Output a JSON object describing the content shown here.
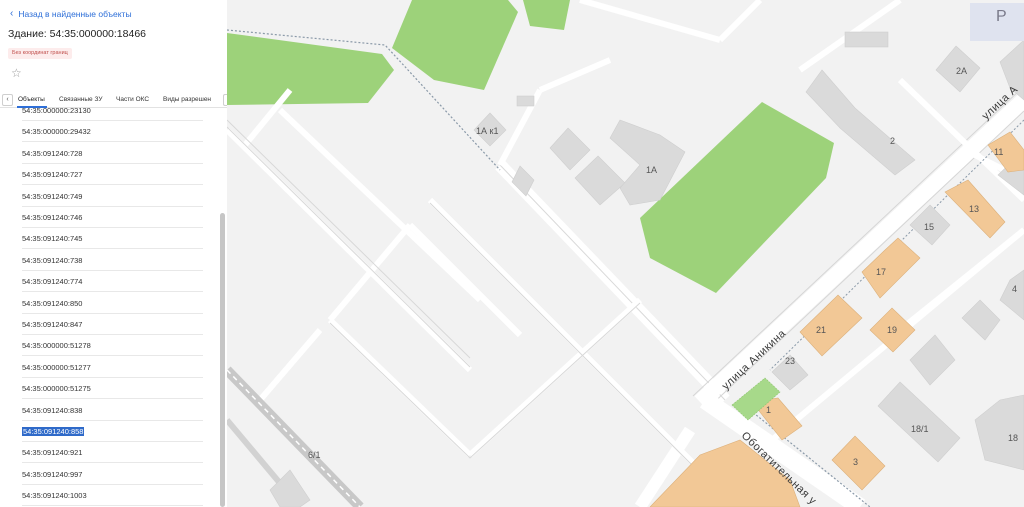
{
  "panel": {
    "back_label": "Назад в найденные объекты",
    "title": "Здание: 54:35:000000:18466",
    "badge": "Без координат границ",
    "tabs": [
      {
        "label": "Объекты"
      },
      {
        "label": "Связанные ЗУ"
      },
      {
        "label": "Части ОКС"
      },
      {
        "label": "Виды разрешен"
      }
    ],
    "list": [
      {
        "label": "54:35:000000:23130"
      },
      {
        "label": "54:35:000000:29432"
      },
      {
        "label": "54:35:091240:728"
      },
      {
        "label": "54:35:091240:727"
      },
      {
        "label": "54:35:091240:749"
      },
      {
        "label": "54:35:091240:746"
      },
      {
        "label": "54:35:091240:745"
      },
      {
        "label": "54:35:091240:738"
      },
      {
        "label": "54:35:091240:774"
      },
      {
        "label": "54:35:091240:850"
      },
      {
        "label": "54:35:091240:847"
      },
      {
        "label": "54:35:000000:51278"
      },
      {
        "label": "54:35:000000:51277"
      },
      {
        "label": "54:35:000000:51275"
      },
      {
        "label": "54:35:091240:838"
      },
      {
        "label": "54:35:091240:858"
      },
      {
        "label": "54:35:091240:921"
      },
      {
        "label": "54:35:091240:997"
      },
      {
        "label": "54:35:091240:1003"
      }
    ],
    "selected_index": 15
  },
  "map": {
    "streets": {
      "anikina": "улица Аникина",
      "obogatitelnaya": "Обогатительная у",
      "top_right": "улица А"
    },
    "house_numbers": {
      "b1a_k1": "1А к1",
      "b1a": "1А",
      "b2a": "2А",
      "b2": "2",
      "b11": "11",
      "b13": "13",
      "b15": "15",
      "b17": "17",
      "b4": "4",
      "b21": "21",
      "b19": "19",
      "b23": "23",
      "b1": "1",
      "b18_1": "18/1",
      "b18": "18",
      "b3": "3",
      "b6_1": "6/1"
    },
    "parking_letter": "P",
    "colors": {
      "park": "#9dd27a",
      "building_gray": "#dadada",
      "building_orange": "#f2c896",
      "pin": "#8e2d8e",
      "accent": "#2e6fd8"
    }
  }
}
